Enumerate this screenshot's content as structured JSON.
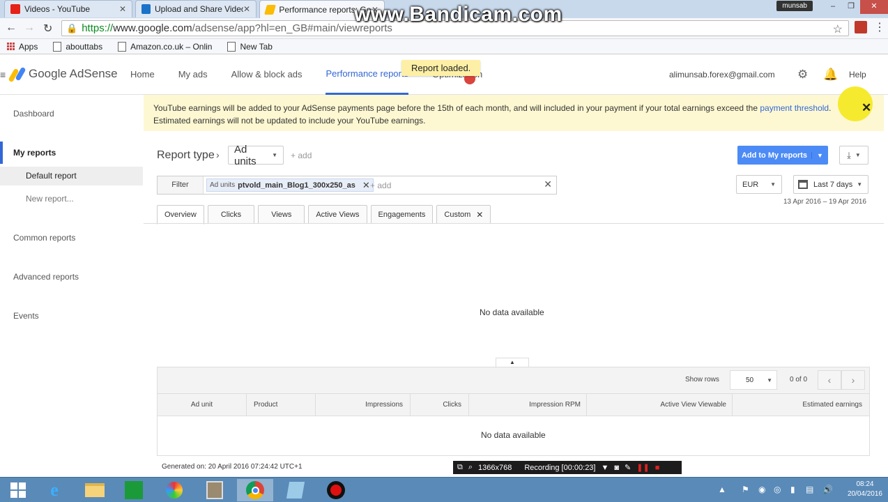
{
  "browser": {
    "tabs": [
      {
        "label": "Videos - YouTube"
      },
      {
        "label": "Upload and Share Videos"
      },
      {
        "label": "Performance reports: Goo"
      }
    ],
    "user": "munsab",
    "url_https": "https://",
    "url_domain": "www.google.com",
    "url_rest": "/adsense/app?hl=en_GB#main/viewreports",
    "watermark": "www.Bandicam.com",
    "bookmarks": {
      "apps": "Apps",
      "items": [
        "abouttabs",
        "Amazon.co.uk – Onlin",
        "New Tab"
      ]
    },
    "window_controls": {
      "minimize": "–",
      "maximize": "❐",
      "close": "✕"
    }
  },
  "header": {
    "logo_text": "Google AdSense",
    "nav": [
      "Home",
      "My ads",
      "Allow & block ads",
      "Performance reports",
      "Optimization"
    ],
    "toast": "Report loaded.",
    "email": "alimunsab.forex@gmail.com",
    "help": "Help"
  },
  "banner": {
    "text": "YouTube earnings will be added to your AdSense payments page before the 15th of each month, and will included in your payment if your total earnings exceed the",
    "link": "payment threshold",
    "text_end": ".",
    "line2": "Estimated earnings will not be updated to include your YouTube earnings."
  },
  "sidebar": {
    "dashboard": "Dashboard",
    "my_reports": "My reports",
    "default_report": "Default report",
    "new_report": "New report...",
    "common_reports": "Common reports",
    "advanced_reports": "Advanced reports",
    "events": "Events"
  },
  "report": {
    "type_label": "Report type",
    "type_value": "Ad units",
    "add": "+ add",
    "add_to_my_reports": "Add to My reports",
    "filter_label": "Filter",
    "filter_chip_label": "Ad units",
    "filter_chip_value": "ptvold_main_Blog1_300x250_as",
    "filter_add": "+ add",
    "currency": "EUR",
    "date_preset": "Last 7 days",
    "date_range": "13 Apr 2016 – 19 Apr 2016",
    "tabs": [
      "Overview",
      "Clicks",
      "Views",
      "Active Views",
      "Engagements",
      "Custom"
    ],
    "no_data_chart": "No data available"
  },
  "table": {
    "show_rows_label": "Show rows",
    "rows_value": "50",
    "page_of": "0 of 0",
    "columns": [
      "Ad unit",
      "Product",
      "Impressions",
      "Clicks",
      "Impression RPM",
      "Active View Viewable",
      "Estimated earnings"
    ],
    "no_data": "No data available"
  },
  "footer": {
    "generated": "Generated on: 20 April 2016 07:24:42 UTC+1"
  },
  "recorder": {
    "resolution": "1366x768",
    "status": "Recording [00:00:23]"
  },
  "taskbar": {
    "time": "08:24",
    "date": "20/04/2016"
  },
  "colors": {
    "accent": "#3367d6",
    "primary_button": "#4c8bf5",
    "banner_bg": "#fdf8d2",
    "toast_bg": "#fdf0a6"
  }
}
